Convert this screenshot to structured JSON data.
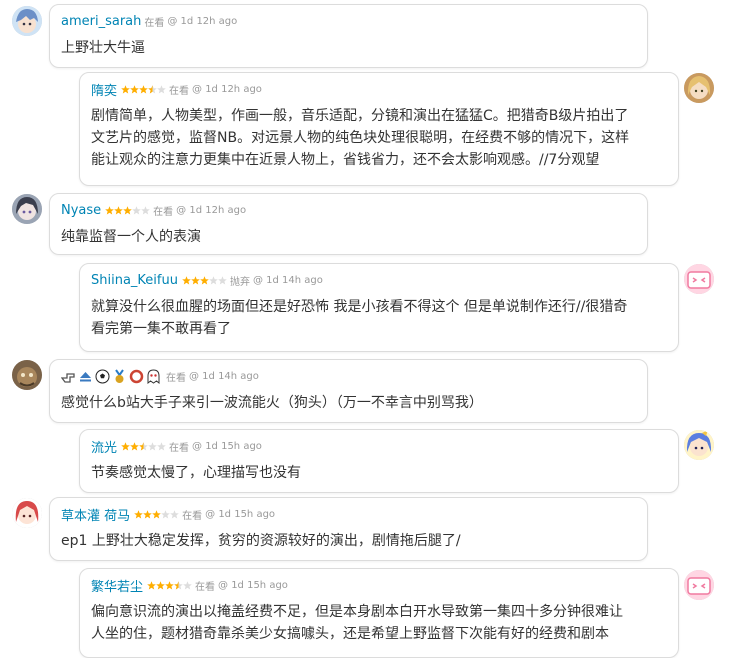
{
  "comments": [
    {
      "user": "ameri_sarah",
      "stars": 0,
      "status": "在看",
      "time": "@ 1d 12h ago",
      "lines": [
        "上野壮大牛逼"
      ]
    },
    {
      "user": "隋奕",
      "stars": 3.5,
      "status": "在看",
      "time": "@ 1d 12h ago",
      "lines": [
        "剧情简单，人物美型，作画一般，音乐适配，分镜和演出在猛猛C。把猎奇B级片拍出了",
        "文艺片的感觉，监督NB。对远景人物的纯色块处理很聪明，在经费不够的情况下，这样",
        "能让观众的注意力更集中在近景人物上，省钱省力，还不会太影响观感。//7分观望"
      ]
    },
    {
      "user": "Nyase",
      "stars": 3,
      "status": "在看",
      "time": "@ 1d 12h ago",
      "lines": [
        "纯靠监督一个人的表演"
      ]
    },
    {
      "user": "Shiina_Keifuu",
      "stars": 3,
      "status": "抛弃",
      "time": "@ 1d 14h ago",
      "lines": [
        "就算没什么很血腥的场面但还是好恐怖 我是小孩看不得这个 但是单说制作还行//很猎奇",
        "看完第一集不敢再看了"
      ]
    },
    {
      "user": "",
      "stars": 0,
      "status": "在看",
      "time": "@ 1d 14h ago",
      "icons": [
        "hand-pointing-icon",
        "eject-icon",
        "soccer-ball-icon",
        "medal-icon",
        "ring-icon",
        "ghost-icon"
      ],
      "lines": [
        "感觉什么b站大手子来引一波流能火（狗头）（万一不幸言中别骂我）"
      ]
    },
    {
      "user": "流光",
      "stars": 2.5,
      "status": "在看",
      "time": "@ 1d 15h ago",
      "lines": [
        "节奏感觉太慢了，心理描写也没有"
      ]
    },
    {
      "user": "草本灌 荷马",
      "stars": 3,
      "status": "在看",
      "time": "@ 1d 15h ago",
      "lines": [
        "ep1 上野壮大稳定发挥，贫穷的资源较好的演出，剧情拖后腿了/"
      ]
    },
    {
      "user": "繁华若尘",
      "stars": 3.5,
      "status": "在看",
      "time": "@ 1d 15h ago",
      "lines": [
        "偏向意识流的演出以掩盖经费不足，但是本身剧本白开水导致第一集四十多分钟很难让",
        "人坐的住，题材猎奇靠杀美少女搞噱头，还是希望上野监督下次能有好的经费和剧本"
      ]
    }
  ],
  "colors": {
    "link": "#0084b4",
    "star_on": "#ffae00",
    "star_off": "#dddddd",
    "meta": "#999999"
  }
}
